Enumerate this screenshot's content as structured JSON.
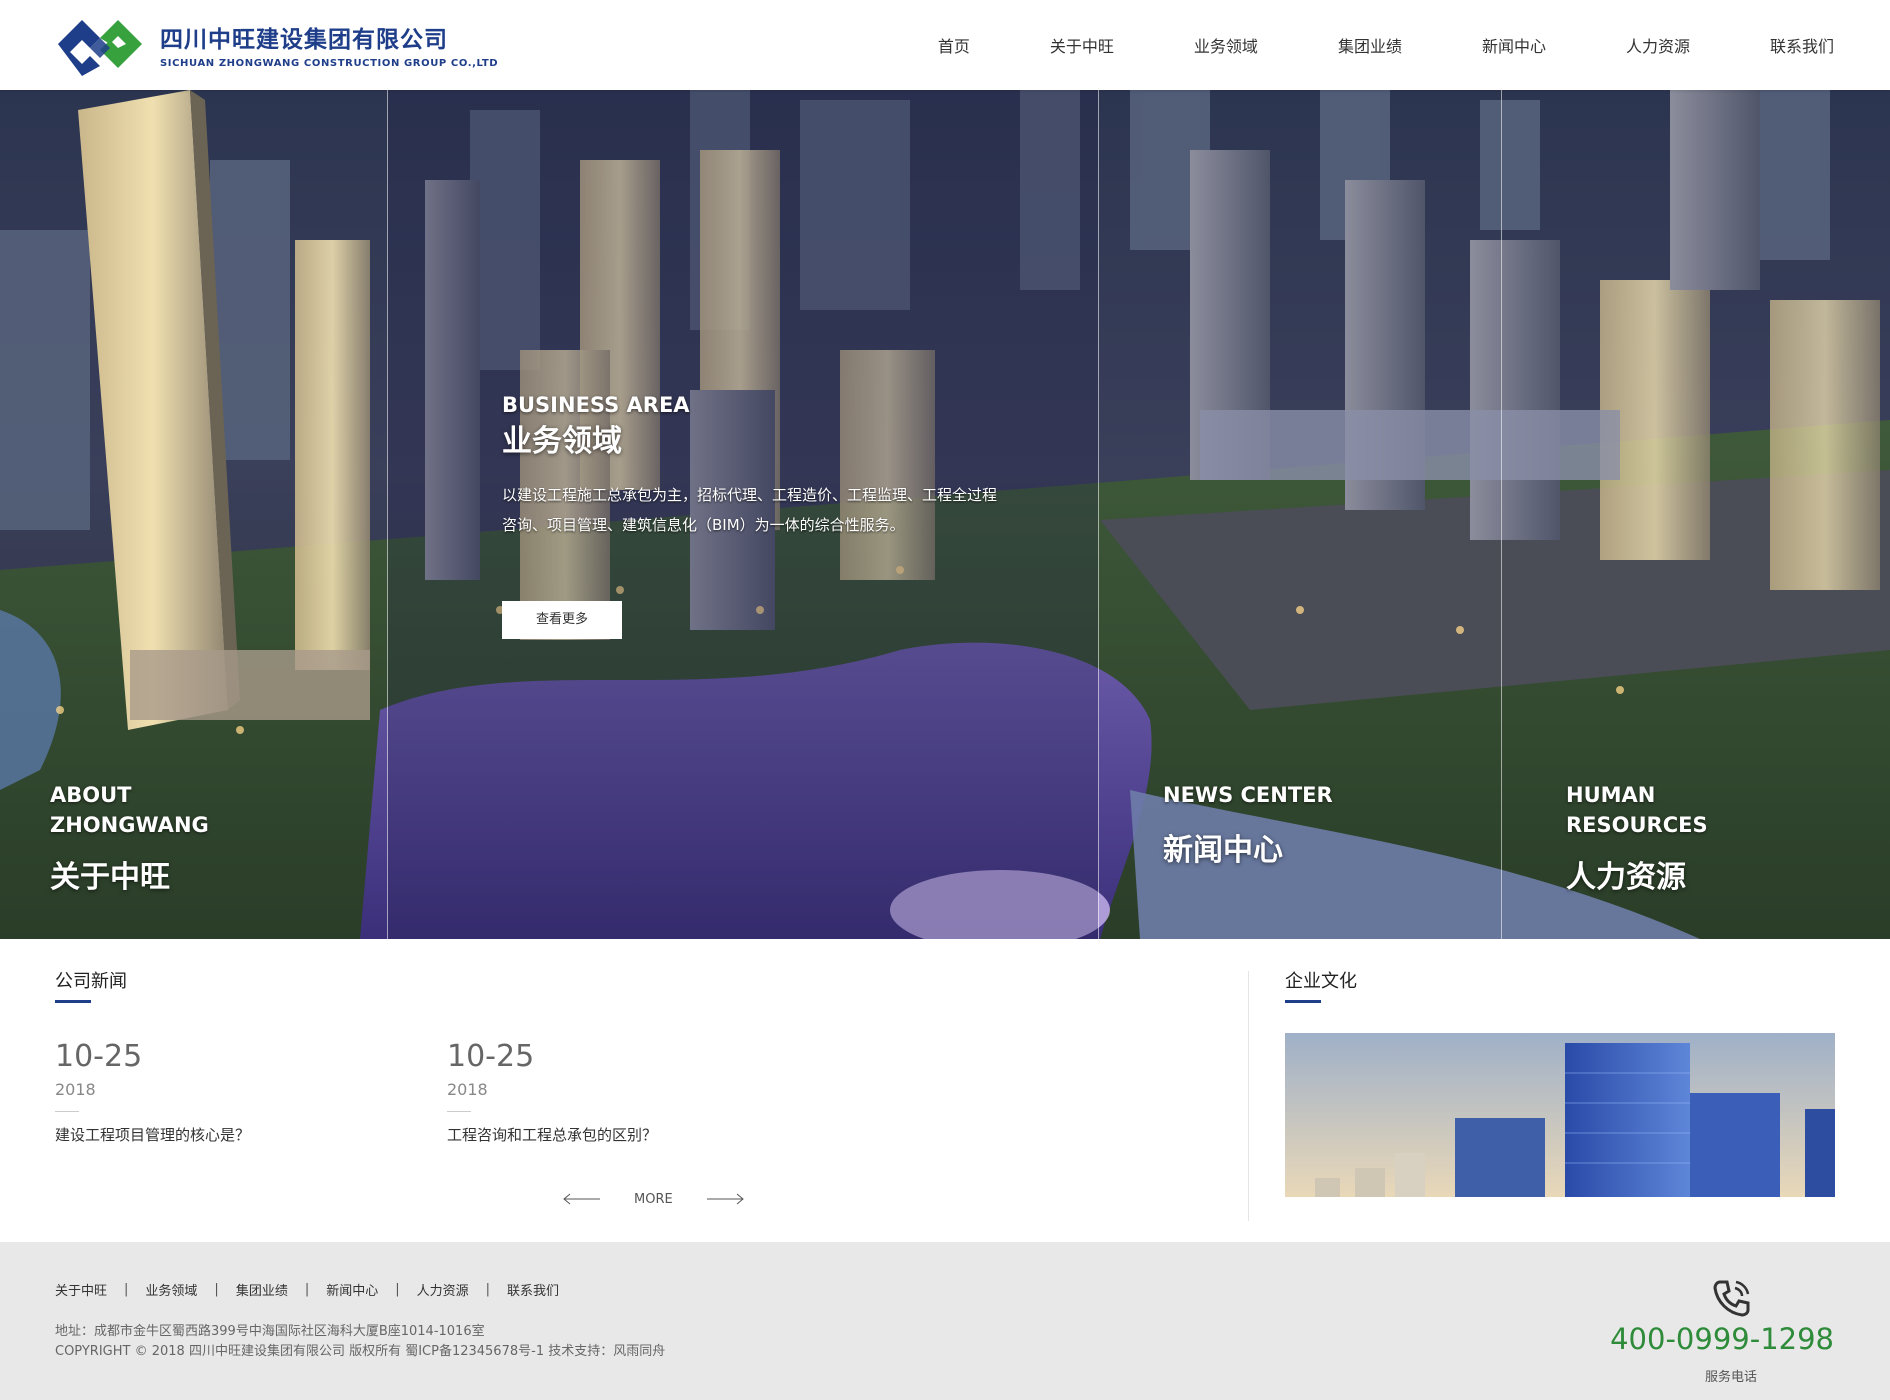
{
  "header": {
    "logo_cn": "四川中旺建设集团有限公司",
    "logo_en": "SICHUAN ZHONGWANG CONSTRUCTION GROUP CO.,LTD",
    "nav": [
      "首页",
      "关于中旺",
      "业务领域",
      "集团业绩",
      "新闻中心",
      "人力资源",
      "联系我们"
    ]
  },
  "hero": {
    "about": {
      "en_line1": "ABOUT",
      "en_line2": "ZHONGWANG",
      "cn": "关于中旺"
    },
    "business": {
      "en": "BUSINESS AREA",
      "cn": "业务领域",
      "desc": "以建设工程施工总承包为主，招标代理、工程造价、工程监理、工程全过程咨询、项目管理、建筑信息化（BIM）为一体的综合性服务。",
      "button": "查看更多"
    },
    "news": {
      "en": "NEWS CENTER",
      "cn": "新闻中心"
    },
    "hr": {
      "en_line1": "HUMAN",
      "en_line2": "RESOURCES",
      "cn": "人力资源"
    }
  },
  "news": {
    "title": "公司新闻",
    "items": [
      {
        "date": "10-25",
        "year": "2018",
        "title": "建设工程项目管理的核心是？"
      },
      {
        "date": "10-25",
        "year": "2018",
        "title": "工程咨询和工程总承包的区别？"
      }
    ],
    "more": "MORE"
  },
  "culture": {
    "title": "企业文化"
  },
  "footer": {
    "links": [
      "关于中旺",
      "业务领域",
      "集团业绩",
      "新闻中心",
      "人力资源",
      "联系我们"
    ],
    "address": "地址：成都市金牛区蜀西路399号中海国际社区海科大厦B座1014-1016室",
    "copyright": "COPYRIGHT © 2018 四川中旺建设集团有限公司 版权所有 蜀ICP备12345678号-1 技术支持：风雨同舟",
    "phone": "400-0999-1298",
    "phone_label": "服务电话"
  },
  "colors": {
    "brand_blue": "#1f3e8a",
    "brand_green": "#2e8b3a",
    "footer_bg": "#e8e8e8"
  }
}
